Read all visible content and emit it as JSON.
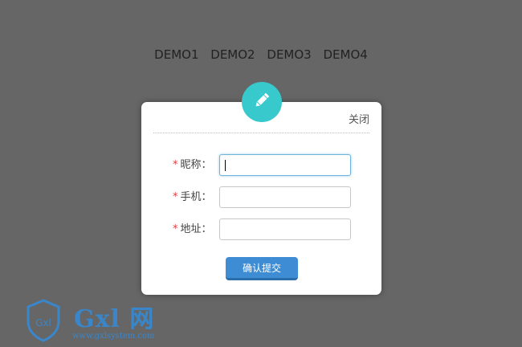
{
  "nav": {
    "links": [
      "DEMO1",
      "DEMO2",
      "DEMO3",
      "DEMO4"
    ]
  },
  "modal": {
    "icon": "pencil-icon",
    "close_label": "关闭",
    "fields": [
      {
        "required_mark": "*",
        "label": "昵称：",
        "value": "",
        "placeholder": ""
      },
      {
        "required_mark": "*",
        "label": "手机：",
        "value": "",
        "placeholder": ""
      },
      {
        "required_mark": "*",
        "label": "地址：",
        "value": "",
        "placeholder": ""
      }
    ],
    "submit_label": "确认提交"
  },
  "watermark": {
    "shield_text": "Gxl",
    "brand": "Gxl 网",
    "url": "www.gxlsystem.com"
  },
  "colors": {
    "background": "#666666",
    "accent": "#38c9cd",
    "button": "#3d8cd4",
    "required": "#e03c3c",
    "watermark": "#2f8ee3"
  }
}
